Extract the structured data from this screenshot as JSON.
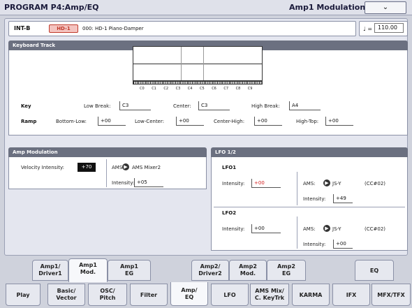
{
  "header": {
    "title": "PROGRAM P4:Amp/EQ",
    "page_menu": "Amp1 Modulation",
    "dropdown_glyph": "⌄"
  },
  "program": {
    "bank": "INT-B",
    "category": "HD-1",
    "name": "000: HD-1 Piano-Damper"
  },
  "tempo": {
    "symbol": "♩ =",
    "value": "110.00"
  },
  "keyboard_track": {
    "title": "Keyboard Track",
    "octaves": [
      "C0",
      "C1",
      "C2",
      "C3",
      "C4",
      "C5",
      "C6",
      "C7",
      "C8",
      "C9"
    ],
    "key": {
      "label": "Key",
      "low_break_label": "Low Break:",
      "low_break": "C3",
      "center_label": "Center:",
      "center": "C3",
      "high_break_label": "High Break:",
      "high_break": "A4"
    },
    "ramp": {
      "label": "Ramp",
      "bottom_low_label": "Bottom-Low:",
      "bottom_low": "+00",
      "low_center_label": "Low-Center:",
      "low_center": "+00",
      "center_high_label": "Center-High:",
      "center_high": "+00",
      "high_top_label": "High-Top:",
      "high_top": "+00"
    }
  },
  "amp_mod": {
    "title": "Amp Modulation",
    "vel_label": "Velocity Intensity:",
    "vel_value": "+70",
    "ams_label": "AMS:",
    "ams_value": "AMS Mixer2",
    "int_label": "Intensity:",
    "int_value": "+05"
  },
  "lfo": {
    "title": "LFO 1/2",
    "lfo1": {
      "name": "LFO1",
      "int_label": "Intensity:",
      "int_value": "+00",
      "ams_label": "AMS:",
      "ams_value": "JS-Y",
      "cc": "(CC#02)",
      "int2_label": "Intensity:",
      "int2_value": "+49"
    },
    "lfo2": {
      "name": "LFO2",
      "int_label": "Intensity:",
      "int_value": "+00",
      "ams_label": "AMS:",
      "ams_value": "JS-Y",
      "cc": "(CC#02)",
      "int2_label": "Intensity:",
      "int2_value": "+00"
    }
  },
  "tabs_top": [
    {
      "l1": "Amp1/",
      "l2": "Driver1"
    },
    {
      "l1": "Amp1",
      "l2": "Mod."
    },
    {
      "l1": "Amp1",
      "l2": "EG"
    },
    {
      "l1": "Amp2/",
      "l2": "Driver2"
    },
    {
      "l1": "Amp2",
      "l2": "Mod."
    },
    {
      "l1": "Amp2",
      "l2": "EG"
    },
    {
      "l1": "EQ",
      "l2": ""
    }
  ],
  "tabs_bottom": [
    {
      "l1": "Play",
      "l2": ""
    },
    {
      "l1": "Basic/",
      "l2": "Vector"
    },
    {
      "l1": "OSC/",
      "l2": "Pitch"
    },
    {
      "l1": "Filter",
      "l2": ""
    },
    {
      "l1": "Amp/",
      "l2": "EQ"
    },
    {
      "l1": "LFO",
      "l2": ""
    },
    {
      "l1": "AMS Mix/",
      "l2": "C. KeyTrk"
    },
    {
      "l1": "KARMA",
      "l2": ""
    },
    {
      "l1": "IFX",
      "l2": ""
    },
    {
      "l1": "MFX/TFX",
      "l2": ""
    }
  ],
  "colors": {
    "header_bg": "#6b7080",
    "accent_red": "#d42020",
    "tag_bg": "#f4c4c0"
  },
  "icons": {
    "ams_arrow": "▶"
  }
}
